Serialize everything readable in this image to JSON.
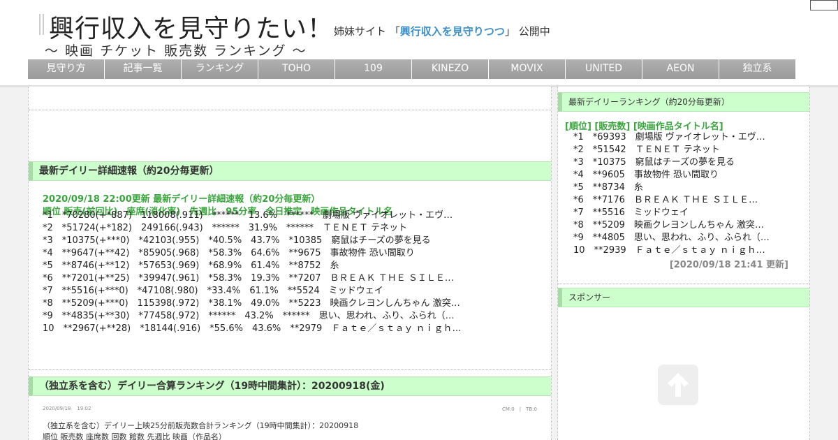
{
  "header": {
    "title": "興行収入を見守りたい！",
    "sister_prefix": "姉妹サイト 「",
    "sister_link": "興行収入を見守りつつ",
    "sister_suffix": "」 公開中",
    "subtitle": "～ 映画 チケット 販売数 ランキング ～"
  },
  "nav": [
    "見守り方",
    "記事一覧",
    "ランキング",
    "TOHO",
    "109",
    "KINEZO",
    "MOVIX",
    "UNITED",
    "AEON",
    "独立系"
  ],
  "main": {
    "section1_title": "最新デイリー詳細速報（約20分毎更新）",
    "ranking_title": "2020/09/18 22:00更新 最新デイリー詳細速報（約20分毎更新）",
    "columns": "順位 販売(前回比)　座席(消化率)　先週比　95分率　全日推定　映画作品タイトル名",
    "rows": [
      "*1　*70280(+*887)　118008(.911)　******　13.6%　******　劇場版 ヴァイオレット・エヴ…",
      "*2　*51724(+*182)　249166(.943)　******　31.9%　******　ＴＥＮＥＴ テネット",
      "*3　*10375(+***0)　*42103(.955)　*40.5%　43.7%　*10385　窮鼠はチーズの夢を見る",
      "*4　**9647(+**42)　*85905(.968)　*58.3%　64.6%　**9675　事故物件 恐い間取り",
      "*5　**8746(+**12)　*57653(.969)　*68.9%　61.4%　**8752　糸",
      "*6　**7201(+**25)　*39947(.961)　*58.3%　19.3%　**7207　ＢＲＥＡＫ ＴＨＥ ＳＩＬＥ…",
      "*7　**5516(+***0)　*47108(.980)　*33.4%　61.1%　**5524　ミッドウェイ",
      "*8　**5209(+***0)　115398(.972)　*38.1%　49.0%　**5223　映画クレヨンしんちゃん 激突…",
      "*9　**4835(+**30)　*77458(.972)　******　43.2%　******　思い、思われ、ふり、ふられ（…",
      "10　**2967(+**28)　*18144(.916)　*55.6%　43.6%　**2979　Ｆａｔｅ／ｓｔａｙ ｎｉｇｈ…"
    ],
    "section2_title": "（独立系を含む）デイリー合算ランキング（19時中間集計）：20200918(金)",
    "post_date": "2020/09/18",
    "post_time": "19:02",
    "post_meta": "CM:0　|　TB:0",
    "post_line1": "（独立系を含む）デイリー上映25分前販売数合計ランキング（19時中間集計）：20200918",
    "post_line2": "順位 販売数 座席数 回数 館数 先週比 映画（作品名）"
  },
  "side": {
    "section1_title": "最新デイリーランキング（約20分毎更新）",
    "columns": "[順位] [販売数] [映画作品タイトル名]",
    "rows": [
      "*1　*69393　劇場版 ヴァイオレット・エヴ…",
      "*2　*51542　ＴＥＮＥＴ テネット",
      "*3　*10375　窮鼠はチーズの夢を見る",
      "*4　**9605　事故物件 恐い間取り",
      "*5　**8734　糸",
      "*6　**7176　ＢＲＥＡＫ ＴＨＥ ＳＩＬＥ…",
      "*7　**5516　ミッドウェイ",
      "*8　**5209　映画クレヨンしんちゃん 激突…",
      "*9　**4805　思い、思われ、ふり、ふられ（…",
      "10　**2939　Ｆａｔｅ／ｓｔａｙ ｎｉｇｈ…"
    ],
    "updated": "[2020/09/18 21:41 更新]",
    "section2_title": "スポンサー"
  },
  "icons": {
    "scroll_top": "arrow-up-icon"
  }
}
